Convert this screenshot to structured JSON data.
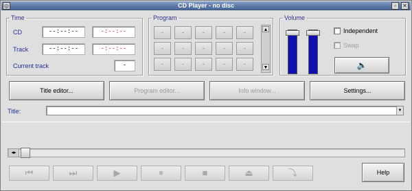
{
  "window": {
    "title": "CD Player - no disc"
  },
  "time": {
    "legend": "Time",
    "cd_label": "CD",
    "track_label": "Track",
    "current_label": "Current track",
    "cd_elapsed": "--:--:--",
    "cd_remaining": "-:--:--",
    "track_elapsed": "--:--:--",
    "track_remaining": "-:--:--",
    "current_track": "-"
  },
  "program": {
    "legend": "Program",
    "cells": [
      "-",
      "-",
      "-",
      "-",
      "-",
      "-",
      "-",
      "-",
      "-",
      "-",
      "-",
      "-",
      "-",
      "-",
      "-"
    ]
  },
  "volume": {
    "legend": "Volume",
    "independent": "Independent",
    "swap": "Swap",
    "independent_checked": false,
    "swap_checked": false,
    "left_level": 0.92,
    "right_level": 0.92
  },
  "buttons": {
    "title_editor": "Title editor...",
    "program_editor": "Program editor...",
    "info_window": "Info window...",
    "settings": "Settings...",
    "help": "Help"
  },
  "title_field": {
    "label": "Title:",
    "value": ""
  },
  "transport": {
    "prev": "⏮",
    "next": "⏭",
    "play": "▶",
    "pause": "⏸",
    "stop": "■",
    "eject": "⏏",
    "shuffle": "⤵"
  },
  "icons": {
    "mute": "speaker-icon",
    "slider_arrows": "◂▸"
  },
  "colors": {
    "title_bar": "#5b79a8",
    "remaining_text": "#e02020",
    "volume_bar": "#1010b0",
    "label_text": "#1f2f9a"
  }
}
